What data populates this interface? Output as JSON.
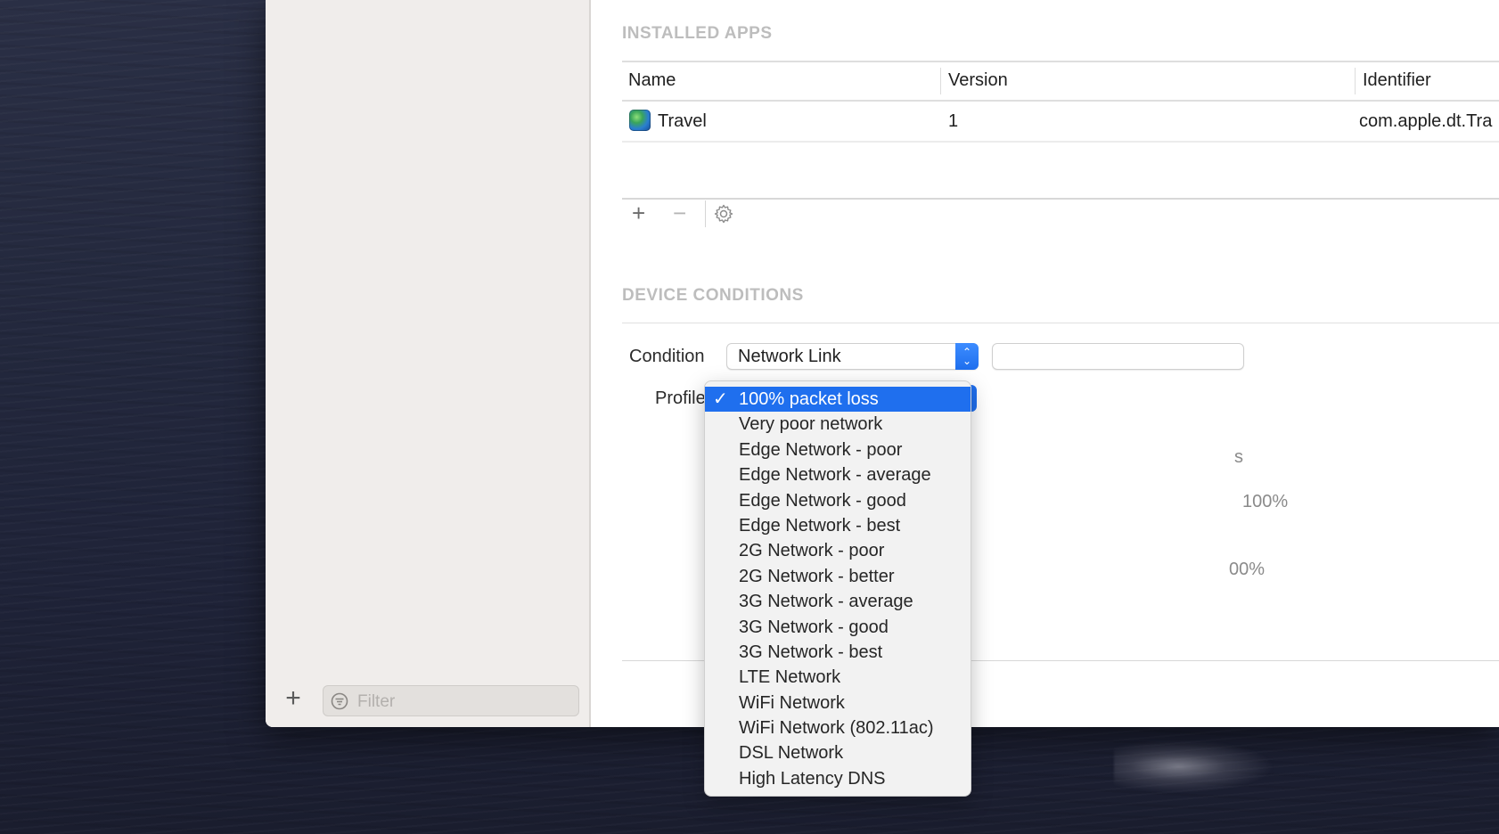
{
  "sidebar": {
    "add_label": "+",
    "filter_placeholder": "Filter"
  },
  "installed_apps": {
    "title": "INSTALLED APPS",
    "columns": [
      "Name",
      "Version",
      "Identifier"
    ],
    "rows": [
      {
        "name": "Travel",
        "version": "1",
        "identifier": "com.apple.dt.Tra"
      }
    ],
    "toolbar": {
      "add": "+",
      "remove": "−"
    }
  },
  "device_conditions": {
    "title": "DEVICE CONDITIONS",
    "condition_label": "Condition",
    "condition_value": "Network Link",
    "profile_label": "Profile",
    "background_text": [
      "s",
      "100%",
      "00%"
    ]
  },
  "profile_menu": {
    "selected_index": 0,
    "items": [
      "100% packet loss",
      "Very poor network",
      "Edge Network - poor",
      "Edge Network - average",
      "Edge Network - good",
      "Edge Network - best",
      "2G Network - poor",
      "2G Network - better",
      "3G Network - average",
      "3G Network - good",
      "3G Network - best",
      "LTE Network",
      "WiFi Network",
      "WiFi Network (802.11ac)",
      "DSL Network",
      "High Latency DNS"
    ]
  },
  "colors": {
    "accent": "#1f6fee",
    "section_title": "#bdbdbd",
    "sidebar_bg": "#f0edeb"
  }
}
